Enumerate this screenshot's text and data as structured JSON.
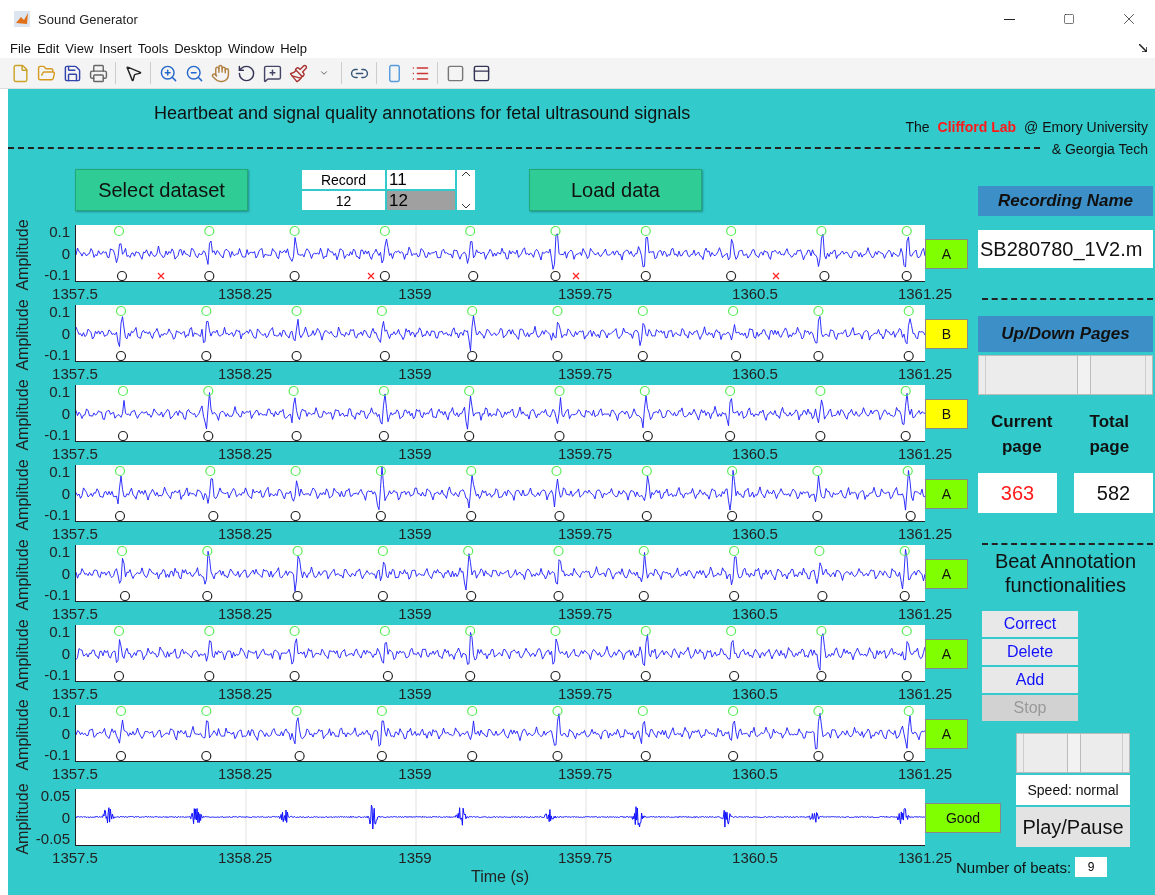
{
  "window": {
    "title": "Sound Generator"
  },
  "menu": [
    "File",
    "Edit",
    "View",
    "Insert",
    "Tools",
    "Desktop",
    "Window",
    "Help"
  ],
  "header": {
    "title": "Heartbeat and signal quality annotations for fetal ultrasound signals",
    "credit_prefix": "The",
    "lab": "Clifford Lab",
    "affiliation": "@ Emory University",
    "affiliation_line_2": "& Georgia Tech"
  },
  "controls": {
    "select_button": "Select dataset",
    "record_label": "Record",
    "record_value": "12",
    "record_list": [
      {
        "text": "11",
        "selected": false
      },
      {
        "text": "12",
        "selected": true
      }
    ],
    "load_button": "Load data"
  },
  "plots": [
    {
      "kind": "signal",
      "ylabel": "Amplitude",
      "yticks": [
        "0.1",
        "0",
        "-0.1"
      ],
      "xticks": [
        "1357.5",
        "1358.25",
        "1359",
        "1359.75",
        "1360.5",
        "1361.25"
      ],
      "tag": {
        "label": "A",
        "color": "#80ff00"
      }
    },
    {
      "kind": "signal",
      "ylabel": "Amplitude",
      "yticks": [
        "0.1",
        "0",
        "-0.1"
      ],
      "xticks": [
        "1357.5",
        "1358.25",
        "1359",
        "1359.75",
        "1360.5",
        "1361.25"
      ],
      "tag": {
        "label": "B",
        "color": "#ffff00"
      }
    },
    {
      "kind": "signal",
      "ylabel": "Amplitude",
      "yticks": [
        "0.1",
        "0",
        "-0.1"
      ],
      "xticks": [
        "1357.5",
        "1358.25",
        "1359",
        "1359.75",
        "1360.5",
        "1361.25"
      ],
      "tag": {
        "label": "B",
        "color": "#ffff00"
      }
    },
    {
      "kind": "signal",
      "ylabel": "Amplitude",
      "yticks": [
        "0.1",
        "0",
        "-0.1"
      ],
      "xticks": [
        "1357.5",
        "1358.25",
        "1359",
        "1359.75",
        "1360.5",
        "1361.25"
      ],
      "tag": {
        "label": "A",
        "color": "#80ff00"
      }
    },
    {
      "kind": "signal",
      "ylabel": "Amplitude",
      "yticks": [
        "0.1",
        "0",
        "-0.1"
      ],
      "xticks": [
        "1357.5",
        "1358.25",
        "1359",
        "1359.75",
        "1360.5",
        "1361.25"
      ],
      "tag": {
        "label": "A",
        "color": "#80ff00"
      }
    },
    {
      "kind": "signal",
      "ylabel": "Amplitude",
      "yticks": [
        "0.1",
        "0",
        "-0.1"
      ],
      "xticks": [
        "1357.5",
        "1358.25",
        "1359",
        "1359.75",
        "1360.5",
        "1361.25"
      ],
      "tag": {
        "label": "A",
        "color": "#80ff00"
      }
    },
    {
      "kind": "signal",
      "ylabel": "Amplitude",
      "yticks": [
        "0.1",
        "0",
        "-0.1"
      ],
      "xticks": [
        "1357.5",
        "1358.25",
        "1359",
        "1359.75",
        "1360.5",
        "1361.25"
      ],
      "tag": {
        "label": "A",
        "color": "#80ff00"
      }
    },
    {
      "kind": "audio",
      "ylabel": "Amplitude",
      "yticks": [
        "0.05",
        "0",
        "-0.05"
      ],
      "xticks": [
        "1357.5",
        "1358.25",
        "1359",
        "1359.75",
        "1360.5",
        "1361.25"
      ],
      "xlabel": "Time (s)",
      "tag": {
        "label": "Good",
        "color": "#80ff00"
      }
    }
  ],
  "recording": {
    "header": "Recording Name",
    "value": "SB280780_1V2.m"
  },
  "pages": {
    "header": "Up/Down Pages",
    "slider": {
      "level": 0.62
    },
    "current_label": "Current page",
    "total_label": "Total page",
    "current": "363",
    "total": "582"
  },
  "beat_annotation": {
    "title": "Beat Annotation functionalities",
    "buttons": [
      {
        "label": "Correct",
        "disabled": false
      },
      {
        "label": "Delete",
        "disabled": false
      },
      {
        "label": "Add",
        "disabled": false
      },
      {
        "label": "Stop",
        "disabled": true
      }
    ]
  },
  "playback": {
    "speed_slider": {
      "level": 0.5
    },
    "speed": "Speed: normal",
    "play_button": "Play/Pause"
  },
  "beats": {
    "label": "Number of beats:",
    "value": "9"
  }
}
